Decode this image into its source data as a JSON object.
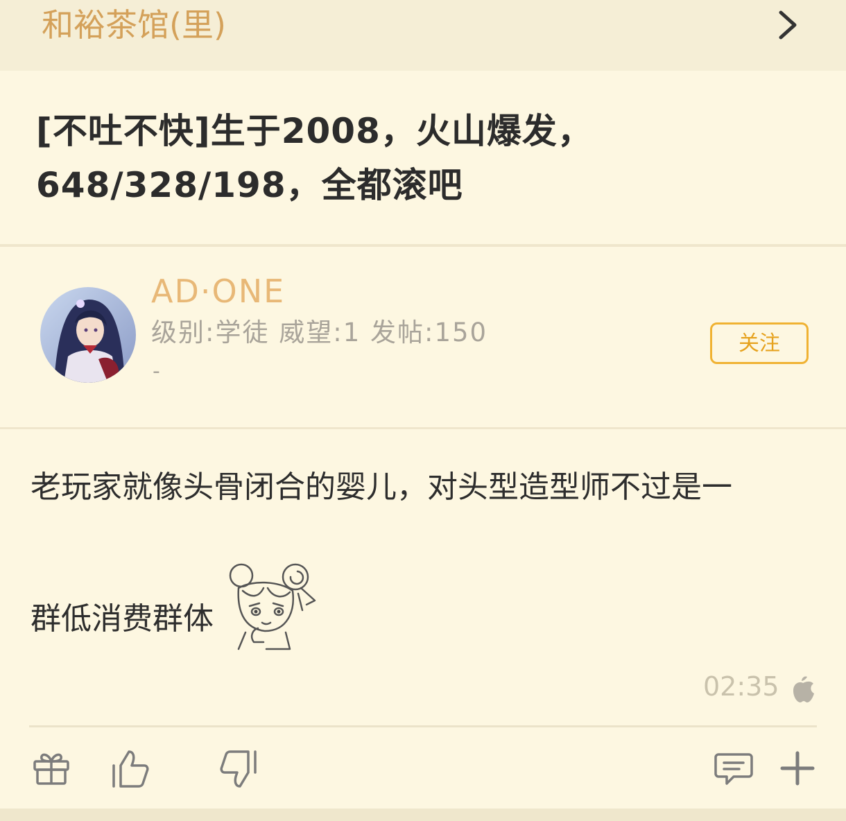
{
  "header": {
    "forum_name": "和裕茶馆(里)",
    "chevron_icon": "chevron-right-icon"
  },
  "post": {
    "title": "[不吐不快]生于2008，火山爆发，648/328/198，全都滚吧"
  },
  "author": {
    "name": "AD·ONE",
    "stats": "级别:学徒 威望:1 发帖:150",
    "signature": "-",
    "follow_label": "关注",
    "avatar_icon": "anime-girl-avatar"
  },
  "content": {
    "line1": "老玩家就像头骨闭合的婴儿，对头型造型师不过是一",
    "line2": "群低消费群体",
    "sticker": "chibi-girl-thinking-sticker"
  },
  "meta": {
    "time": "02:35",
    "device_icon": "apple-icon"
  },
  "actions": {
    "icons": [
      "gift-icon",
      "thumbs-up-icon",
      "thumbs-down-icon",
      "comment-icon",
      "plus-icon"
    ]
  },
  "colors": {
    "background": "#fdf7e1",
    "header_bg": "#f5eed6",
    "accent": "#f0b232",
    "forum_name": "#d4a15a",
    "username": "#e8b877"
  }
}
